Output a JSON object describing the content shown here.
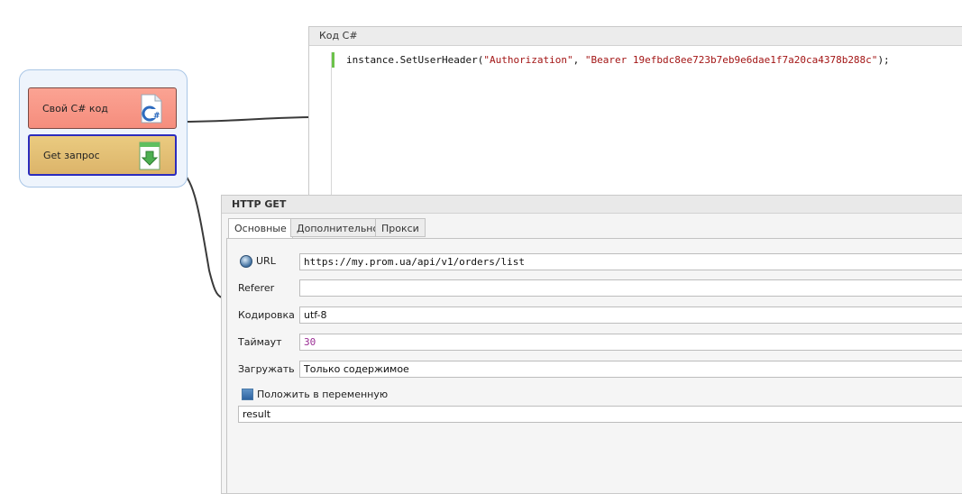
{
  "blocks": [
    {
      "label": "Свой C# код",
      "icon": "csharp-file-icon",
      "color": "#f9988a"
    },
    {
      "label": "Get запрос",
      "icon": "download-arrow-icon",
      "color": "#e3bf74"
    }
  ],
  "cs_panel": {
    "title": "Код C#",
    "code": {
      "prefix": "instance.SetUserHeader(",
      "arg1": "\"Authorization\"",
      "sep": ", ",
      "arg2": "\"Bearer 19efbdc8ee723b7eb9e6dae1f7a20ca4378b288c\"",
      "suffix": ");"
    }
  },
  "http_panel": {
    "title": "HTTP GET",
    "tabs": [
      "Основные",
      "Дополнительно",
      "Прокси"
    ],
    "active_tab": 0,
    "fields": {
      "url_label": "URL",
      "url_value": "https://my.prom.ua/api/v1/orders/list",
      "referer_label": "Referer",
      "referer_value": "",
      "encoding_label": "Кодировка",
      "encoding_value": "utf-8",
      "timeout_label": "Таймаут",
      "timeout_value": "30",
      "load_label": "Загружать",
      "load_value": "Только содержимое",
      "save_label": "Положить в переменную",
      "save_checked": true,
      "variable_value": "result"
    }
  }
}
